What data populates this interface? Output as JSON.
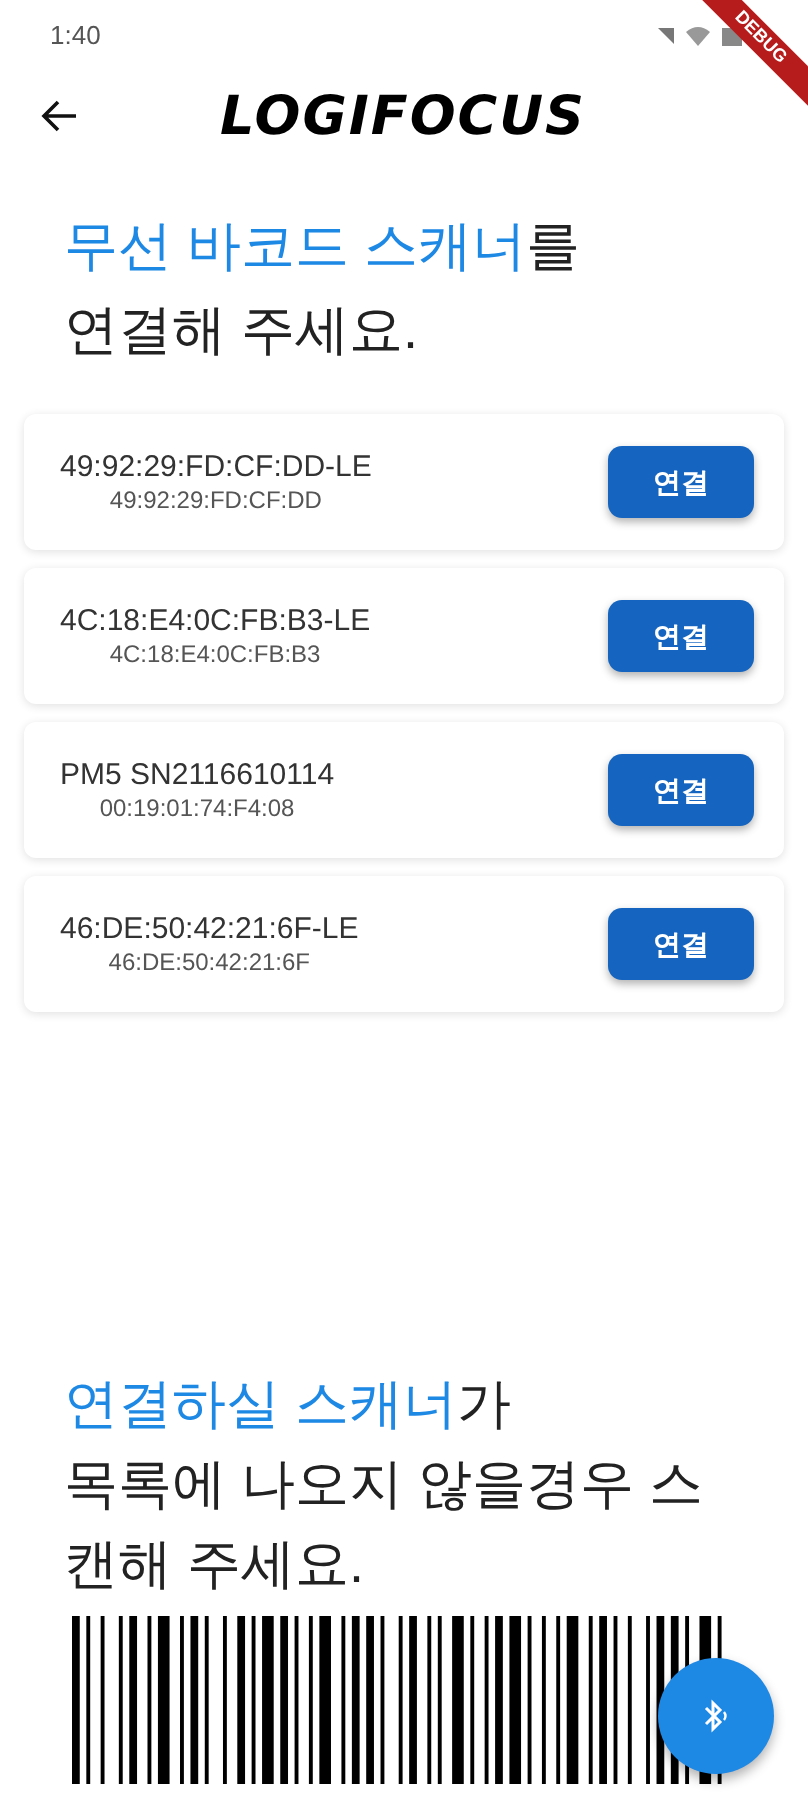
{
  "status_bar": {
    "time": "1:40"
  },
  "debug_banner": {
    "label": "DEBUG"
  },
  "app_bar": {
    "logo": "LOGIFOCUS"
  },
  "intro": {
    "parts": [
      {
        "text": "무선 바코드 스캐너",
        "highlight": true
      },
      {
        "text": "를",
        "highlight": false
      }
    ],
    "line_2": "연결해 주세요."
  },
  "devices": [
    {
      "name": "49:92:29:FD:CF:DD-LE",
      "address": "49:92:29:FD:CF:DD",
      "button": "연결"
    },
    {
      "name": "4C:18:E4:0C:FB:B3-LE",
      "address": "4C:18:E4:0C:FB:B3",
      "button": "연결"
    },
    {
      "name": "PM5 SN2116610114",
      "address": "00:19:01:74:F4:08",
      "button": "연결"
    },
    {
      "name": "46:DE:50:42:21:6F-LE",
      "address": "46:DE:50:42:21:6F",
      "button": "연결"
    }
  ],
  "hint": {
    "parts": [
      {
        "text": "연결하실 스캐너",
        "highlight": true
      },
      {
        "text": "가",
        "highlight": false
      }
    ],
    "line_2": "목록에 나오지 않을경우 스",
    "line_3": "캔해 주세요."
  }
}
